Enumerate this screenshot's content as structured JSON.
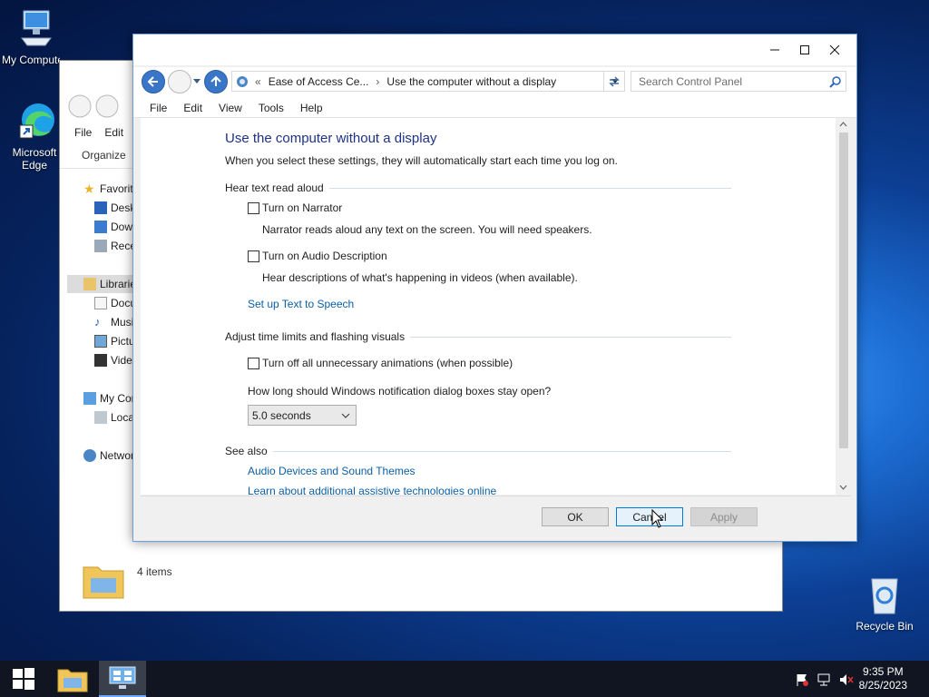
{
  "desktop": {
    "icons": [
      {
        "label": "My Computer"
      },
      {
        "label": "Microsoft Edge"
      },
      {
        "label": "Recycle Bin"
      }
    ]
  },
  "explorer": {
    "menu": [
      "File",
      "Edit"
    ],
    "organize": "Organize",
    "nav": [
      {
        "label": "Favorites"
      },
      {
        "label": "Desktop"
      },
      {
        "label": "Downloads"
      },
      {
        "label": "Recent places"
      },
      {
        "label": "Libraries"
      },
      {
        "label": "Documents"
      },
      {
        "label": "Music"
      },
      {
        "label": "Pictures"
      },
      {
        "label": "Videos"
      },
      {
        "label": "My Computer"
      },
      {
        "label": "Local Disk"
      },
      {
        "label": "Network"
      }
    ],
    "status": "4 items"
  },
  "dialog": {
    "breadcrumb": {
      "overflow": "«",
      "parent": "Ease of Access Ce...",
      "separator": "›",
      "current": "Use the computer without a display"
    },
    "search_placeholder": "Search Control Panel",
    "menu": [
      "File",
      "Edit",
      "View",
      "Tools",
      "Help"
    ],
    "title": "Use the computer without a display",
    "subtitle": "When you select these settings, they will automatically start each time you log on.",
    "sections": {
      "hear": "Hear text read aloud",
      "adjust": "Adjust time limits and flashing visuals",
      "see_also": "See also"
    },
    "options": {
      "narrator": {
        "label": "Turn on Narrator",
        "desc": "Narrator reads aloud any text on the screen. You will need speakers.",
        "checked": false
      },
      "audio_desc": {
        "label": "Turn on Audio Description",
        "desc": "Hear descriptions of what's happening in videos (when available).",
        "checked": false
      },
      "animations": {
        "label": "Turn off all unnecessary animations (when possible)",
        "checked": false
      }
    },
    "tts_link": "Set up Text to Speech",
    "notification_question": "How long should Windows notification dialog boxes stay open?",
    "notification_value": "5.0 seconds",
    "links": {
      "audio": "Audio Devices and Sound Themes",
      "learn": "Learn about additional assistive technologies online"
    },
    "buttons": {
      "ok": "OK",
      "cancel": "Cancel",
      "apply": "Apply"
    }
  },
  "taskbar": {
    "time": "9:35 PM",
    "date": "8/25/2023"
  },
  "colors": {
    "link": "#0b5fa5",
    "title": "#1e3287",
    "taskbar": "#101521"
  }
}
